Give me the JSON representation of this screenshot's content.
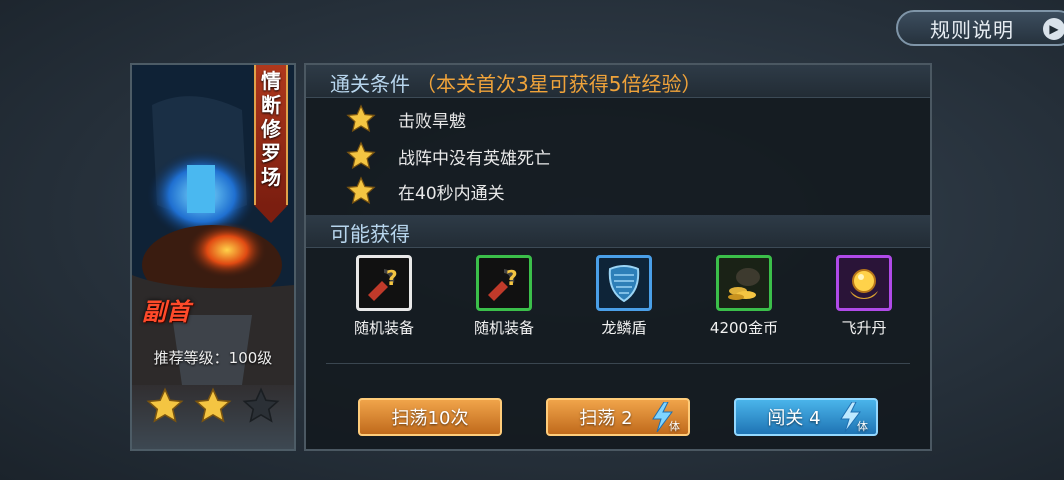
{
  "top": {
    "rules_label": "规则说明"
  },
  "stage": {
    "name": "情断修罗场",
    "boss_tag": "副首",
    "recommended_level": "推荐等级：100级",
    "stars_earned": 2,
    "stars_total": 3
  },
  "conditions": {
    "title": "通关条件",
    "bonus_note": "（本关首次3星可获得5倍经验）",
    "items": [
      {
        "text": "击败旱魃"
      },
      {
        "text": "战阵中没有英雄死亡"
      },
      {
        "text": "在40秒内通关"
      }
    ]
  },
  "rewards": {
    "title": "可能获得",
    "items": [
      {
        "name": "随机装备",
        "icon": "random-equipment-icon",
        "frame_color": "#e8e8e8"
      },
      {
        "name": "随机装备",
        "icon": "random-equipment-icon",
        "frame_color": "#3bbf4a"
      },
      {
        "name": "龙鳞盾",
        "icon": "dragon-scale-shield-icon",
        "frame_color": "#4a9fe8"
      },
      {
        "name": "4200金币",
        "icon": "gold-coins-icon",
        "frame_color": "#3bbf4a"
      },
      {
        "name": "飞升丹",
        "icon": "ascension-pill-icon",
        "frame_color": "#b04ae8"
      }
    ]
  },
  "actions": {
    "sweep10_label": "扫荡10次",
    "sweep_label": "扫荡 2",
    "challenge_label": "闯关 4",
    "stamina_label": "体"
  },
  "colors": {
    "accent_orange": "#f0a33a",
    "heading_blue": "#b8d6ee",
    "button_orange": "#e08a34",
    "button_blue": "#2f94d2"
  }
}
